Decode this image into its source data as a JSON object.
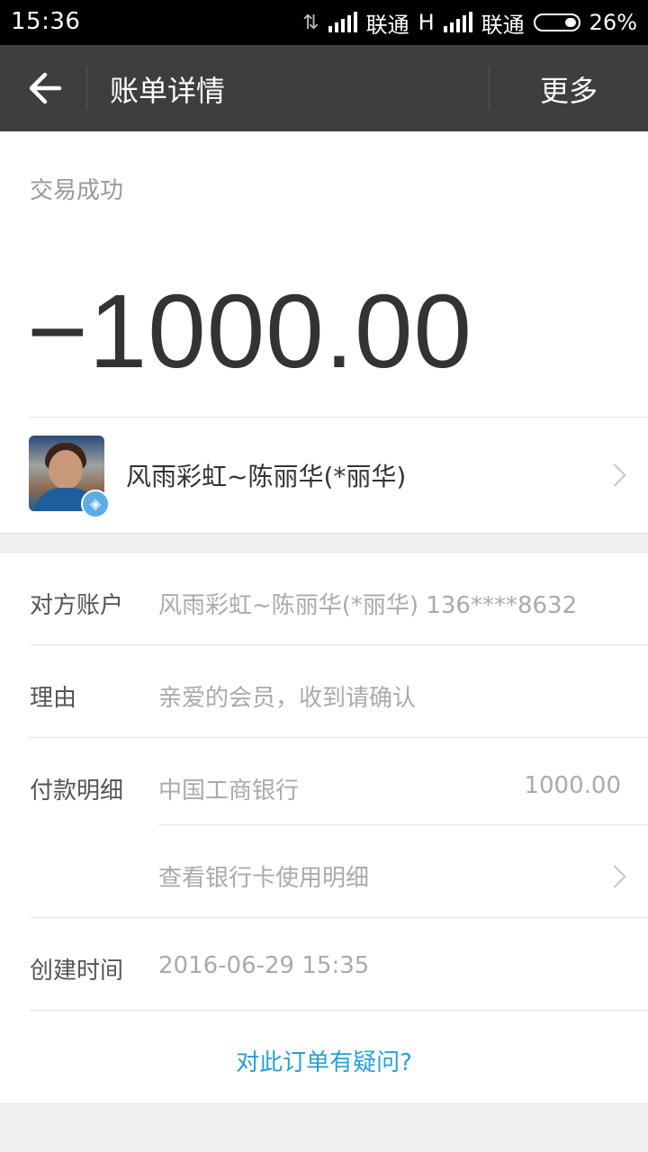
{
  "status_bar": {
    "time": "15:36",
    "carrier1": "联通",
    "network1": "H",
    "carrier2": "联通",
    "battery": "26%"
  },
  "header": {
    "title": "账单详情",
    "more": "更多",
    "back_icon": "arrow-left-icon"
  },
  "transaction": {
    "status": "交易成功",
    "amount": "−1000.00"
  },
  "counterparty": {
    "name": "风雨彩虹~陈丽华(*丽华)",
    "badge_icon": "verified-badge-icon"
  },
  "details": {
    "account_label": "对方账户",
    "account_value": "风雨彩虹~陈丽华(*丽华) 136****8632",
    "reason_label": "理由",
    "reason_value": "亲爱的会员，收到请确认",
    "payment_label": "付款明细",
    "payment_bank": "中国工商银行",
    "payment_amount": "1000.00",
    "card_usage_link": "查看银行卡使用明细",
    "created_label": "创建时间",
    "created_value": "2016-06-29 15:35"
  },
  "question_link": "对此订单有疑问?",
  "colors": {
    "accent": "#27a0d8",
    "titlebar": "#3e3e3e"
  }
}
